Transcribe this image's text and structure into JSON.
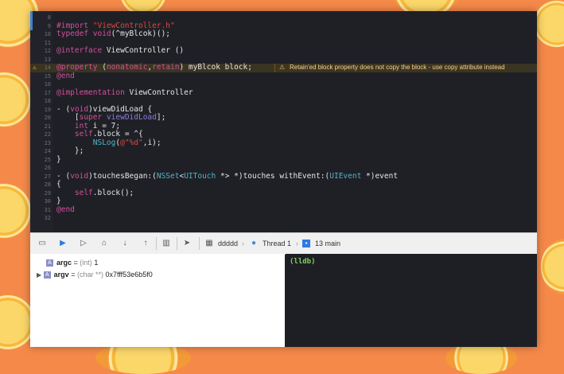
{
  "editor": {
    "lines": [
      {
        "num": "8",
        "parts": []
      },
      {
        "num": "9",
        "parts": [
          {
            "t": "#import ",
            "c": "k"
          },
          {
            "t": "\"ViewController.h\"",
            "c": "s"
          }
        ]
      },
      {
        "num": "10",
        "parts": [
          {
            "t": "typedef ",
            "c": "k"
          },
          {
            "t": "void",
            "c": "k"
          },
          {
            "t": "(^myBlcok)();",
            "c": "y"
          }
        ]
      },
      {
        "num": "11",
        "parts": []
      },
      {
        "num": "12",
        "parts": [
          {
            "t": "@interface ",
            "c": "k"
          },
          {
            "t": "ViewController ()",
            "c": "y"
          }
        ]
      },
      {
        "num": "13",
        "parts": []
      },
      {
        "num": "14",
        "warn": true,
        "parts": [
          {
            "t": "@property ",
            "c": "k"
          },
          {
            "t": "(",
            "c": "y"
          },
          {
            "t": "nonatomic",
            "c": "k"
          },
          {
            "t": ",",
            "c": "y"
          },
          {
            "t": "retain",
            "c": "k"
          },
          {
            "t": ") myBlcok block;",
            "c": "y"
          }
        ]
      },
      {
        "num": "15",
        "parts": [
          {
            "t": "@end",
            "c": "k"
          }
        ]
      },
      {
        "num": "16",
        "parts": []
      },
      {
        "num": "17",
        "parts": [
          {
            "t": "@implementation ",
            "c": "k"
          },
          {
            "t": "ViewController",
            "c": "y"
          }
        ]
      },
      {
        "num": "18",
        "parts": []
      },
      {
        "num": "19",
        "parts": [
          {
            "t": "- (",
            "c": "y"
          },
          {
            "t": "void",
            "c": "k"
          },
          {
            "t": ")viewDidLoad {",
            "c": "y"
          }
        ]
      },
      {
        "num": "20",
        "parts": [
          {
            "t": "    [",
            "c": "y"
          },
          {
            "t": "super ",
            "c": "k"
          },
          {
            "t": "viewDidLoad",
            "c": "n"
          },
          {
            "t": "];",
            "c": "y"
          }
        ]
      },
      {
        "num": "21",
        "parts": [
          {
            "t": "    int ",
            "c": "k"
          },
          {
            "t": "i = 7;",
            "c": "y"
          }
        ]
      },
      {
        "num": "22",
        "parts": [
          {
            "t": "    ",
            "c": "y"
          },
          {
            "t": "self",
            "c": "k"
          },
          {
            "t": ".block = ^{",
            "c": "y"
          }
        ]
      },
      {
        "num": "23",
        "parts": [
          {
            "t": "        ",
            "c": "y"
          },
          {
            "t": "NSLog",
            "c": "c"
          },
          {
            "t": "(",
            "c": "y"
          },
          {
            "t": "@\"%d\"",
            "c": "s"
          },
          {
            "t": ",i);",
            "c": "y"
          }
        ]
      },
      {
        "num": "24",
        "parts": [
          {
            "t": "    };",
            "c": "y"
          }
        ]
      },
      {
        "num": "25",
        "parts": [
          {
            "t": "}",
            "c": "y"
          }
        ]
      },
      {
        "num": "26",
        "parts": []
      },
      {
        "num": "27",
        "parts": [
          {
            "t": "- (",
            "c": "y"
          },
          {
            "t": "void",
            "c": "k"
          },
          {
            "t": ")touchesBegan:(",
            "c": "y"
          },
          {
            "t": "NSSet",
            "c": "c"
          },
          {
            "t": "<",
            "c": "y"
          },
          {
            "t": "UITouch",
            "c": "c"
          },
          {
            "t": " *> *)touches withEvent:(",
            "c": "y"
          },
          {
            "t": "UIEvent",
            "c": "c"
          },
          {
            "t": " *)event",
            "c": "y"
          }
        ]
      },
      {
        "num": "28",
        "parts": [
          {
            "t": "{",
            "c": "y"
          }
        ]
      },
      {
        "num": "29",
        "parts": [
          {
            "t": "    ",
            "c": "y"
          },
          {
            "t": "self",
            "c": "k"
          },
          {
            "t": ".block();",
            "c": "y"
          }
        ]
      },
      {
        "num": "30",
        "parts": [
          {
            "t": "}",
            "c": "y"
          }
        ]
      },
      {
        "num": "31",
        "parts": [
          {
            "t": "@end",
            "c": "k"
          }
        ]
      },
      {
        "num": "32",
        "parts": []
      }
    ],
    "warning_text": "Retain'ed block property does not copy the block - use copy attribute instead"
  },
  "debugbar": {
    "target": "ddddd",
    "thread": "Thread 1",
    "frame": "13 main"
  },
  "variables": [
    {
      "name": "argc",
      "type": "(int)",
      "value": "1"
    },
    {
      "name": "argv",
      "type": "(char **)",
      "value": "0x7fff53e6b5f0"
    }
  ],
  "console": {
    "prompt": "(lldb)"
  },
  "colors": {
    "accent": "#3c82d9",
    "warning": "#f2c14e",
    "background": "#f5894a"
  }
}
